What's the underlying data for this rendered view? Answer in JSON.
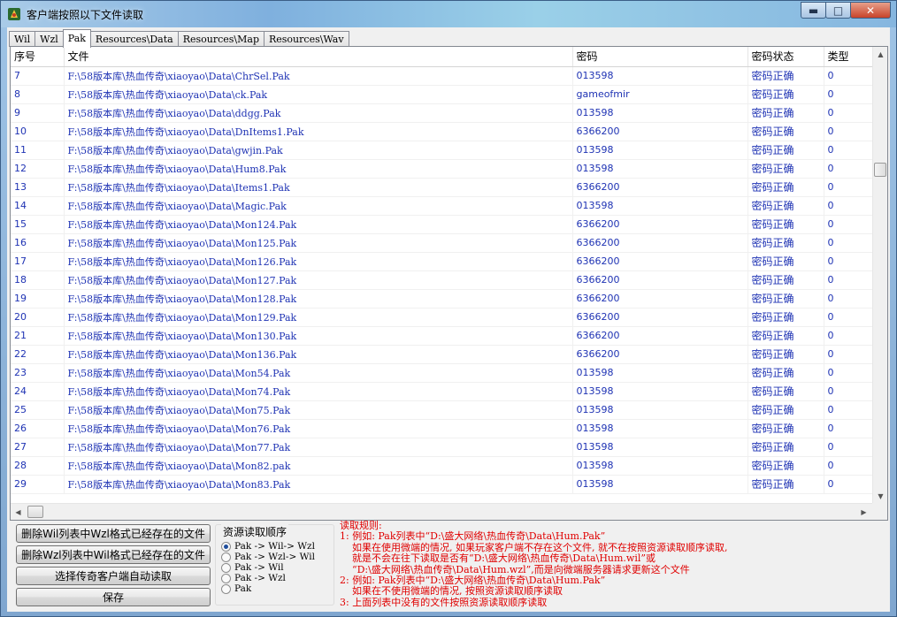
{
  "window": {
    "title": "客户端按照以下文件读取",
    "min_label": "▬",
    "max_label": "□",
    "close_label": "✕"
  },
  "tabs": [
    {
      "label": "Wil",
      "active": false
    },
    {
      "label": "Wzl",
      "active": false
    },
    {
      "label": "Pak",
      "active": true
    },
    {
      "label": "Resources\\Data",
      "active": false
    },
    {
      "label": "Resources\\Map",
      "active": false
    },
    {
      "label": "Resources\\Wav",
      "active": false
    }
  ],
  "table": {
    "columns": [
      "序号",
      "文件",
      "密码",
      "密码状态",
      "类型"
    ],
    "rows": [
      [
        "7",
        "F:\\58版本库\\热血传奇\\xiaoyao\\Data\\ChrSel.Pak",
        "013598",
        "密码正确",
        "0"
      ],
      [
        "8",
        "F:\\58版本库\\热血传奇\\xiaoyao\\Data\\ck.Pak",
        "gameofmir",
        "密码正确",
        "0"
      ],
      [
        "9",
        "F:\\58版本库\\热血传奇\\xiaoyao\\Data\\ddgg.Pak",
        "013598",
        "密码正确",
        "0"
      ],
      [
        "10",
        "F:\\58版本库\\热血传奇\\xiaoyao\\Data\\DnItems1.Pak",
        "6366200",
        "密码正确",
        "0"
      ],
      [
        "11",
        "F:\\58版本库\\热血传奇\\xiaoyao\\Data\\gwjin.Pak",
        "013598",
        "密码正确",
        "0"
      ],
      [
        "12",
        "F:\\58版本库\\热血传奇\\xiaoyao\\Data\\Hum8.Pak",
        "013598",
        "密码正确",
        "0"
      ],
      [
        "13",
        "F:\\58版本库\\热血传奇\\xiaoyao\\Data\\Items1.Pak",
        "6366200",
        "密码正确",
        "0"
      ],
      [
        "14",
        "F:\\58版本库\\热血传奇\\xiaoyao\\Data\\Magic.Pak",
        "013598",
        "密码正确",
        "0"
      ],
      [
        "15",
        "F:\\58版本库\\热血传奇\\xiaoyao\\Data\\Mon124.Pak",
        "6366200",
        "密码正确",
        "0"
      ],
      [
        "16",
        "F:\\58版本库\\热血传奇\\xiaoyao\\Data\\Mon125.Pak",
        "6366200",
        "密码正确",
        "0"
      ],
      [
        "17",
        "F:\\58版本库\\热血传奇\\xiaoyao\\Data\\Mon126.Pak",
        "6366200",
        "密码正确",
        "0"
      ],
      [
        "18",
        "F:\\58版本库\\热血传奇\\xiaoyao\\Data\\Mon127.Pak",
        "6366200",
        "密码正确",
        "0"
      ],
      [
        "19",
        "F:\\58版本库\\热血传奇\\xiaoyao\\Data\\Mon128.Pak",
        "6366200",
        "密码正确",
        "0"
      ],
      [
        "20",
        "F:\\58版本库\\热血传奇\\xiaoyao\\Data\\Mon129.Pak",
        "6366200",
        "密码正确",
        "0"
      ],
      [
        "21",
        "F:\\58版本库\\热血传奇\\xiaoyao\\Data\\Mon130.Pak",
        "6366200",
        "密码正确",
        "0"
      ],
      [
        "22",
        "F:\\58版本库\\热血传奇\\xiaoyao\\Data\\Mon136.Pak",
        "6366200",
        "密码正确",
        "0"
      ],
      [
        "23",
        "F:\\58版本库\\热血传奇\\xiaoyao\\Data\\Mon54.Pak",
        "013598",
        "密码正确",
        "0"
      ],
      [
        "24",
        "F:\\58版本库\\热血传奇\\xiaoyao\\Data\\Mon74.Pak",
        "013598",
        "密码正确",
        "0"
      ],
      [
        "25",
        "F:\\58版本库\\热血传奇\\xiaoyao\\Data\\Mon75.Pak",
        "013598",
        "密码正确",
        "0"
      ],
      [
        "26",
        "F:\\58版本库\\热血传奇\\xiaoyao\\Data\\Mon76.Pak",
        "013598",
        "密码正确",
        "0"
      ],
      [
        "27",
        "F:\\58版本库\\热血传奇\\xiaoyao\\Data\\Mon77.Pak",
        "013598",
        "密码正确",
        "0"
      ],
      [
        "28",
        "F:\\58版本库\\热血传奇\\xiaoyao\\Data\\Mon82.pak",
        "013598",
        "密码正确",
        "0"
      ],
      [
        "29",
        "F:\\58版本库\\热血传奇\\xiaoyao\\Data\\Mon83.Pak",
        "013598",
        "密码正确",
        "0"
      ]
    ]
  },
  "buttons": {
    "delete_wil": "删除Wil列表中Wzl格式已经存在的文件",
    "delete_wzl": "删除Wzl列表中Wil格式已经存在的文件",
    "select_client": "选择传奇客户端自动读取",
    "save": "保存"
  },
  "resource_order": {
    "title": "资源读取顺序",
    "options": [
      {
        "label": "Pak -> Wil-> Wzl",
        "selected": true
      },
      {
        "label": "Pak -> Wzl-> Wil",
        "selected": false
      },
      {
        "label": "Pak -> Wil",
        "selected": false
      },
      {
        "label": "Pak -> Wzl",
        "selected": false
      },
      {
        "label": "Pak",
        "selected": false
      }
    ]
  },
  "rules": {
    "lines": [
      "读取规则:",
      "1: 例如: Pak列表中“D:\\盛大网络\\热血传奇\\Data\\Hum.Pak”",
      "    如果在使用微端的情况, 如果玩家客户端不存在这个文件, 就不在按照资源读取顺序读取,",
      "    就是不会在往下读取是否有“D:\\盛大网络\\热血传奇\\Data\\Hum.wil”或",
      "    “D:\\盛大网络\\热血传奇\\Data\\Hum.wzl”,而是向微端服务器请求更新这个文件",
      "2: 例如: Pak列表中“D:\\盛大网络\\热血传奇\\Data\\Hum.Pak”",
      "    如果在不使用微端的情况, 按照资源读取顺序读取",
      "3: 上面列表中没有的文件按照资源读取顺序读取"
    ]
  },
  "colors": {
    "cell_text": "#1f33b4",
    "rules_text": "#e00000"
  }
}
